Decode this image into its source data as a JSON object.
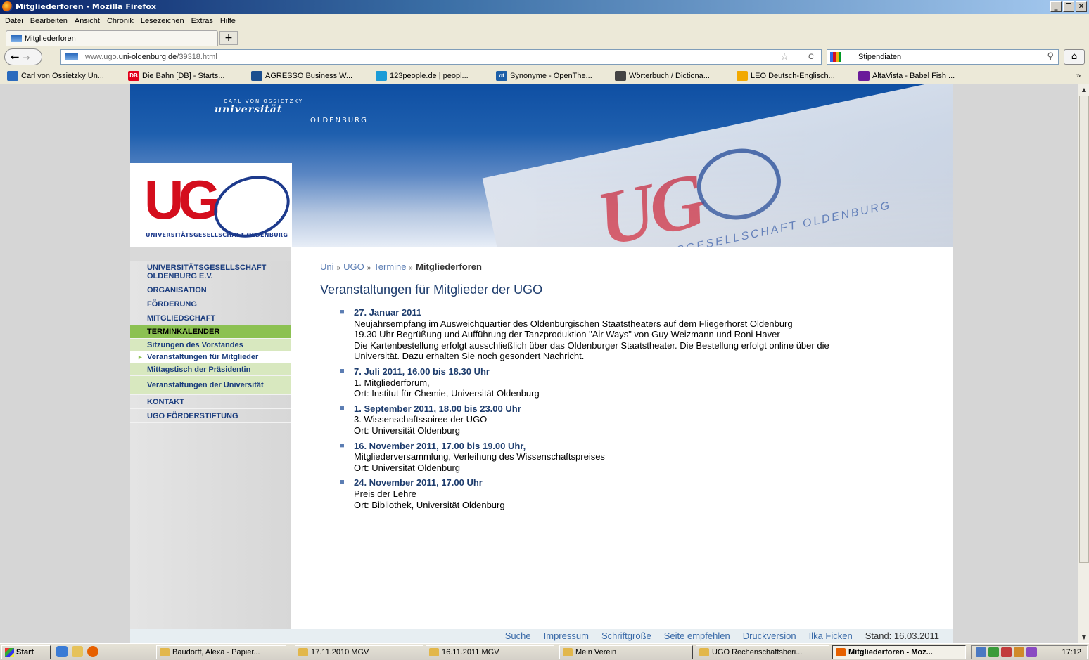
{
  "window": {
    "title": "Mitgliederforen - Mozilla Firefox",
    "controls": [
      "_",
      "❐",
      "✕"
    ]
  },
  "menu": [
    "Datei",
    "Bearbeiten",
    "Ansicht",
    "Chronik",
    "Lesezeichen",
    "Extras",
    "Hilfe"
  ],
  "tab": {
    "label": "Mitgliederforen",
    "new_tab": "+"
  },
  "nav": {
    "back": "←",
    "forward": "→",
    "url_prefix": "www.ugo.",
    "url_domain": "uni-oldenburg.de",
    "url_path": "/39318.html",
    "star": "☆",
    "reload": "C",
    "search_value": "Stipendiaten",
    "search_icon": "magnifier-icon",
    "home": "⌂"
  },
  "bookmarks": [
    {
      "label": "Carl von Ossietzky Un...",
      "badge": "",
      "color": "#2b6bbd"
    },
    {
      "label": "Die Bahn [DB] - Starts...",
      "badge": "DB",
      "color": "#e2001a"
    },
    {
      "label": "AGRESSO Business W...",
      "badge": "",
      "color": "#1c4f8f"
    },
    {
      "label": "123people.de | peopl...",
      "badge": "",
      "color": "#1a9bd7"
    },
    {
      "label": "Synonyme - OpenThe...",
      "badge": "ot",
      "color": "#1d5fa8"
    },
    {
      "label": "Wörterbuch / Dictiona...",
      "badge": "",
      "color": "#444"
    },
    {
      "label": "LEO Deutsch-Englisch...",
      "badge": "",
      "color": "#f2a900"
    },
    {
      "label": "AltaVista - Babel Fish ...",
      "badge": "",
      "color": "#6a1b9a"
    }
  ],
  "bookmarks_overflow": "»",
  "header": {
    "uni_small": "CARL VON OSSIETZKY",
    "uni_big": "universität",
    "uni_city": "OLDENBURG",
    "ugo_letters": "UG",
    "ugo_caption": "UNIVERSITÄTSGESELLSCHAFT OLDENBURG",
    "banner_letters": "UG",
    "banner_text": "UNIVERSITÄTSGESELLSCHAFT OLDENBURG"
  },
  "sidenav": [
    {
      "label": "UNIVERSITÄTSGESELLSCHAFT OLDENBURG E.V.",
      "type": "main"
    },
    {
      "label": "ORGANISATION",
      "type": "main"
    },
    {
      "label": "FÖRDERUNG",
      "type": "main"
    },
    {
      "label": "MITGLIEDSCHAFT",
      "type": "main"
    },
    {
      "label": "TERMINKALENDER",
      "type": "active"
    },
    {
      "label": "Sitzungen des Vorstandes",
      "type": "sub"
    },
    {
      "label": "Veranstaltungen für Mitglieder",
      "type": "current",
      "marker": "▸"
    },
    {
      "label": "Mittagstisch der Präsidentin",
      "type": "sub"
    },
    {
      "label": "Veranstaltungen der Universität",
      "type": "sub"
    },
    {
      "label": "KONTAKT",
      "type": "main"
    },
    {
      "label": "UGO FÖRDERSTIFTUNG",
      "type": "main"
    }
  ],
  "breadcrumb": {
    "items": [
      "Uni",
      "UGO",
      "Termine"
    ],
    "current": "Mitgliederforen",
    "separator": "»"
  },
  "heading": "Veranstaltungen für Mitglieder der UGO",
  "events": [
    {
      "date": "27. Januar 2011",
      "lines": [
        "Neujahrsempfang im Ausweichquartier des Oldenburgischen Staatstheaters auf dem Fliegerhorst Oldenburg",
        "19.30 Uhr Begrüßung und Aufführung der Tanzproduktion \"Air Ways\" von Guy Weizmann und Roni Haver",
        "Die Kartenbestellung erfolgt ausschließlich über das Oldenburger Staatstheater. Die Bestellung erfolgt online über die Universität. Dazu erhalten Sie noch gesondert Nachricht."
      ]
    },
    {
      "date": "7. Juli 2011, 16.00 bis 18.30 Uhr",
      "lines": [
        "1. Mitgliederforum,",
        "Ort: Institut für Chemie, Universität Oldenburg"
      ]
    },
    {
      "date": "1. September 2011, 18.00 bis 23.00 Uhr",
      "lines": [
        "3. Wissenschaftssoiree der UGO",
        "Ort: Universität Oldenburg"
      ]
    },
    {
      "date": "16. November 2011, 17.00 bis 19.00 Uhr,",
      "lines": [
        "Mitgliederversammlung, Verleihung des Wissenschaftspreises",
        "Ort: Universität Oldenburg"
      ]
    },
    {
      "date": "24. November 2011, 17.00 Uhr",
      "lines": [
        "Preis der Lehre",
        "Ort: Bibliothek, Universität Oldenburg"
      ]
    }
  ],
  "event_bullet": "■",
  "footer": {
    "links": [
      "Suche",
      "Impressum",
      "Schriftgröße",
      "Seite empfehlen",
      "Druckversion",
      "Ilka Ficken"
    ],
    "stand": "Stand: 16.03.2011"
  },
  "taskbar": {
    "start": "Start",
    "buttons": [
      {
        "label": "Baudorff, Alexa - Papier...",
        "active": false
      },
      {
        "label": "17.11.2010 MGV",
        "active": false
      },
      {
        "label": "16.11.2011 MGV",
        "active": false
      },
      {
        "label": "Mein Verein",
        "active": false
      },
      {
        "label": "UGO Rechenschaftsberi...",
        "active": false
      },
      {
        "label": "Mitgliederforen - Moz...",
        "active": true
      }
    ],
    "clock": "17:12"
  }
}
